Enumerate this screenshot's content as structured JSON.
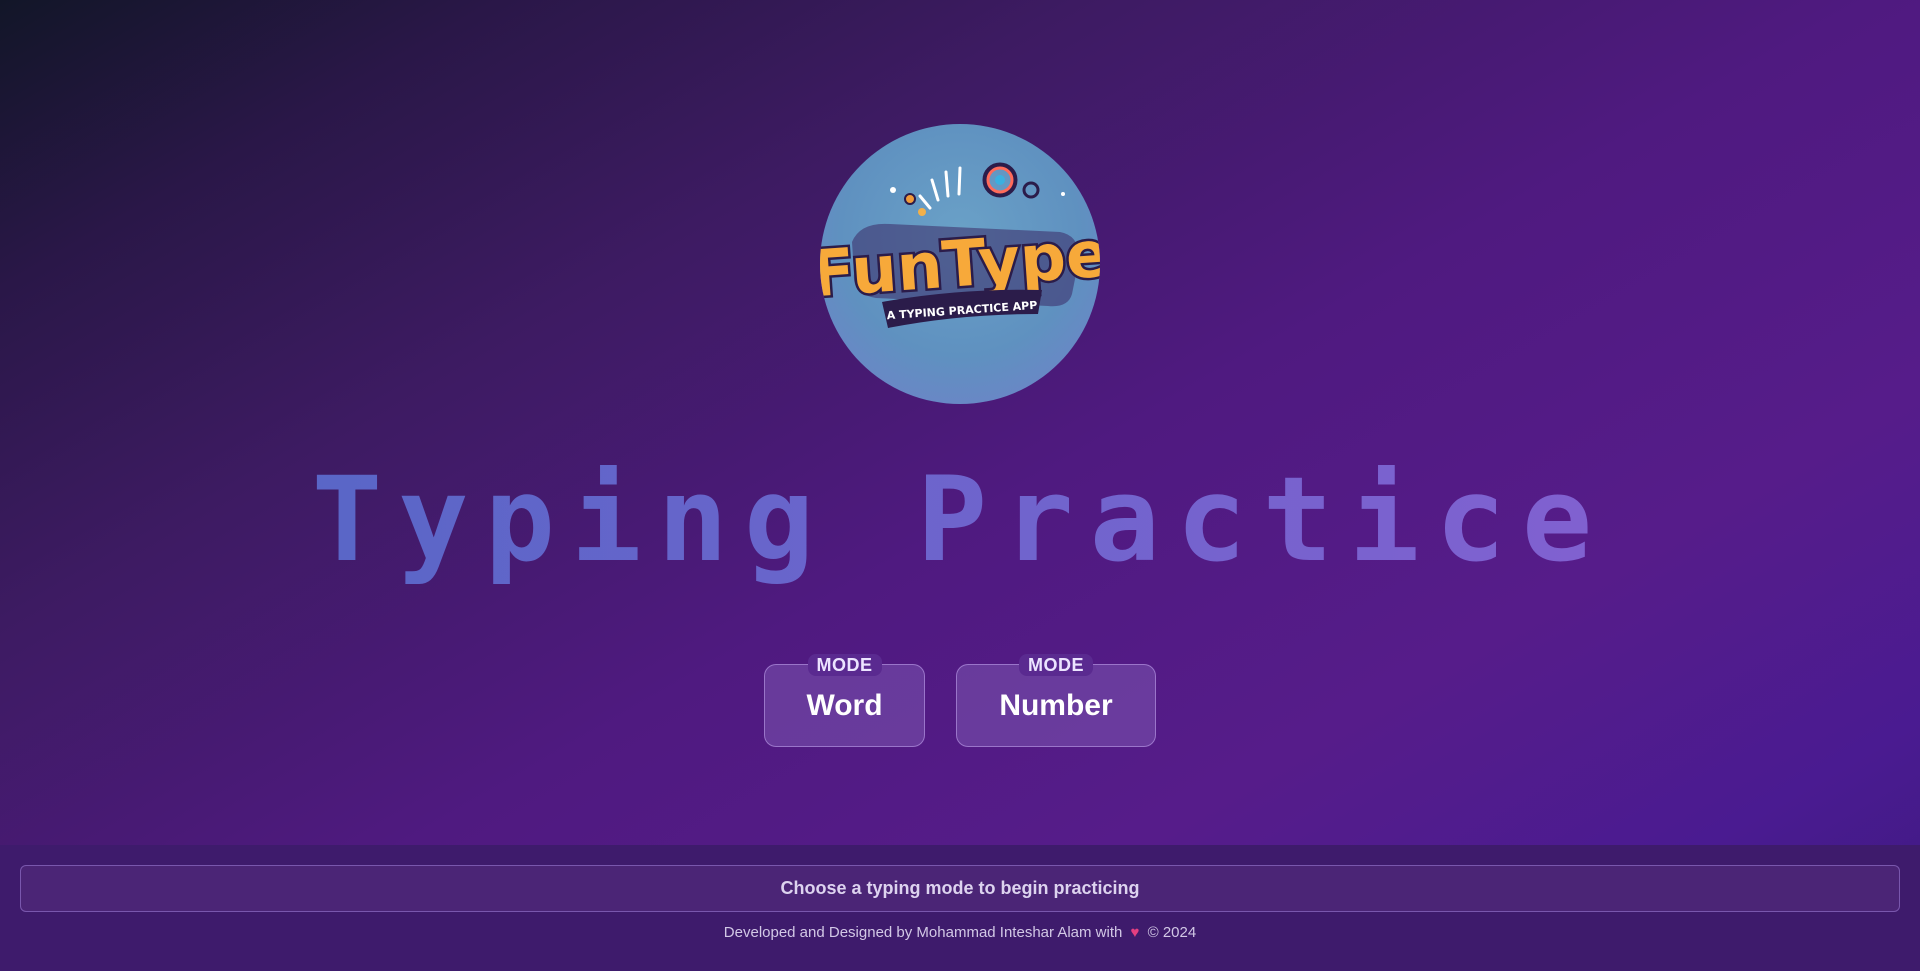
{
  "logo": {
    "brand_text": "FunType",
    "tagline": "A TYPING PRACTICE APP",
    "icon": "funtype-logo"
  },
  "page_title": "Typing Practice",
  "modes": [
    {
      "tag": "MODE",
      "label": "Word"
    },
    {
      "tag": "MODE",
      "label": "Number"
    }
  ],
  "footer": {
    "status_text": "Choose a typing mode to begin practicing",
    "credit_prefix": "Developed and Designed by Mohammad Inteshar Alam with",
    "heart_icon": "heart-icon",
    "credit_suffix": "© 2024"
  },
  "colors": {
    "background_dark": "#121628",
    "background_purple": "#561c8a",
    "title_gradient_start": "#4f66c4",
    "title_gradient_end": "#8a5fd2",
    "footer_bg": "#3e1b6c",
    "heart": "#e43f80"
  }
}
